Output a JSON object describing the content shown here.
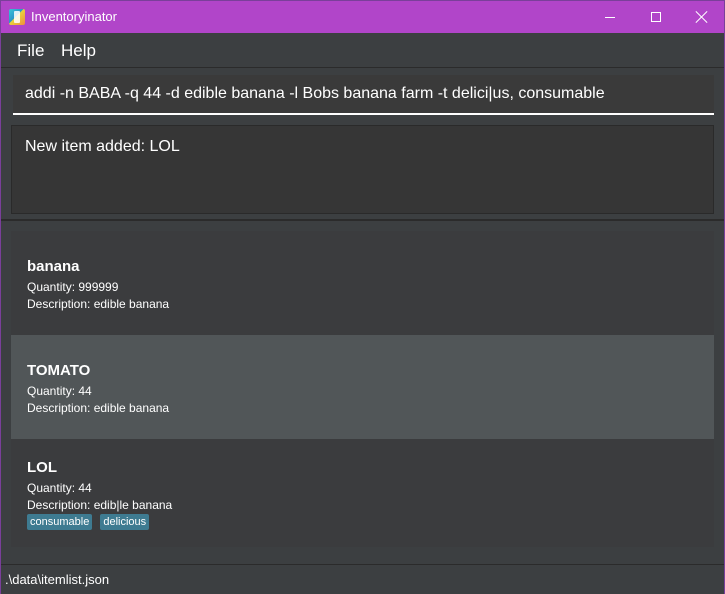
{
  "window": {
    "title": "Inventoryinator",
    "app_icon": "inventoryinator-app-icon"
  },
  "menu": {
    "file_label": "File",
    "help_label": "Help"
  },
  "command": {
    "value": "addi -n BABA -q 44 -d edible banana -l Bobs banana farm -t delici|us, consumable"
  },
  "result": {
    "message": "New item added: LOL"
  },
  "items": [
    {
      "name": "banana",
      "quantity": "Quantity: 999999",
      "description": "Description: edible banana",
      "tags": []
    },
    {
      "name": "TOMATO",
      "quantity": "Quantity: 44",
      "description": "Description: edible banana",
      "tags": []
    },
    {
      "name": "LOL",
      "quantity": "Quantity: 44",
      "description": "Description: edib|le banana",
      "tags": [
        "consumable",
        "delicious"
      ]
    }
  ],
  "status": {
    "path": ".\\data\\itemlist.json"
  },
  "colors": {
    "title_bar": "#b145c9",
    "background": "#3c3f41",
    "selected_card": "#515658",
    "tag": "#3e7b91"
  }
}
